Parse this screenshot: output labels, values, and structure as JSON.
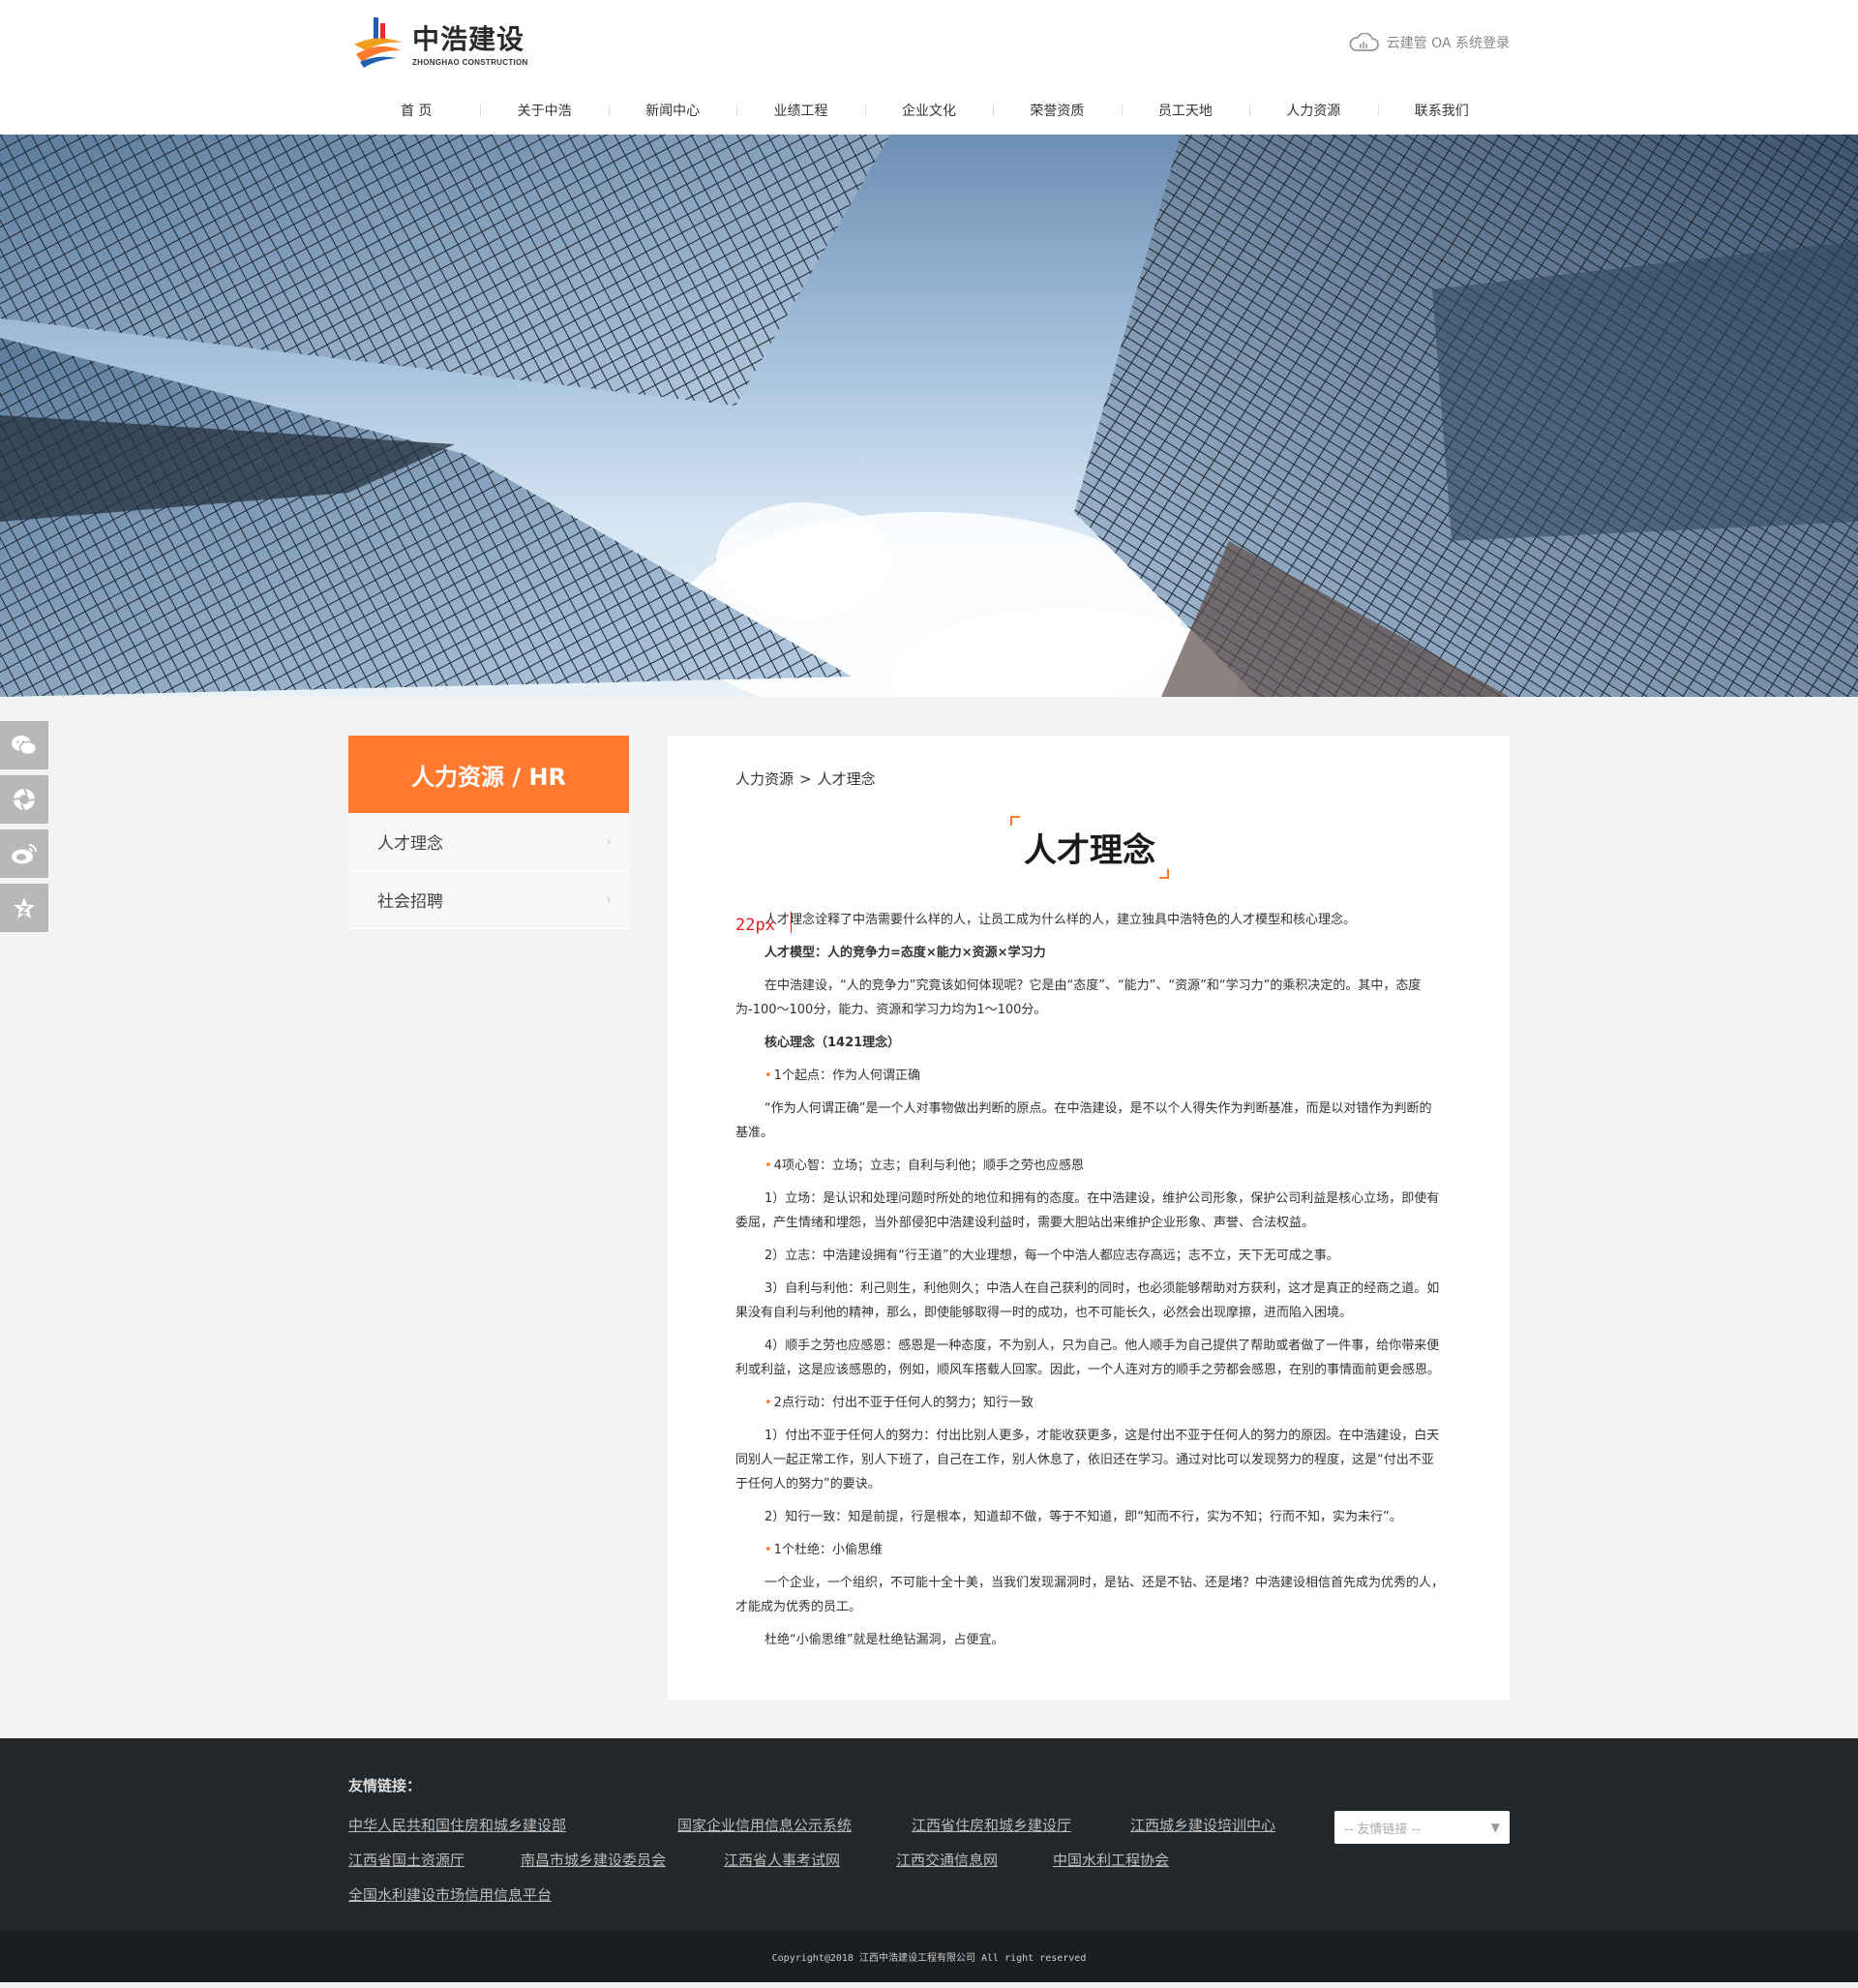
{
  "header": {
    "logo_cn": "中浩建设",
    "logo_en": "ZHONGHAO CONSTRUCTION",
    "oa_login": "云建管 OA 系统登录",
    "nav": [
      "首 页",
      "关于中浩",
      "新闻中心",
      "业绩工程",
      "企业文化",
      "荣誉资质",
      "员工天地",
      "人力资源",
      "联系我们"
    ]
  },
  "sidebar": {
    "title": "人力资源 / HR",
    "items": [
      "人才理念",
      "社会招聘"
    ]
  },
  "content": {
    "breadcrumb": [
      "人力资源",
      "人才理念"
    ],
    "breadcrumb_sep": ">",
    "title": "人才理念",
    "marker": "22px",
    "paragraphs": {
      "p1": "人才理念诠释了中浩需要什么样的人，让员工成为什么样的人，建立独具中浩特色的人才模型和核心理念。",
      "p2": "人才模型：人的竞争力=态度×能力×资源×学习力",
      "p3": "在中浩建设，“人的竞争力”究竟该如何体现呢？它是由“态度”、“能力”、“资源”和“学习力”的乘积决定的。其中，态度为-100～100分，能力、资源和学习力均为1～100分。",
      "p4": "核心理念（1421理念）",
      "p5": "1个起点：作为人何谓正确",
      "p6": "“作为人何谓正确”是一个人对事物做出判断的原点。在中浩建设，是不以个人得失作为判断基准，而是以对错作为判断的基准。",
      "p7": "4项心智：立场；立志；自利与利他；顺手之劳也应感恩",
      "p8": "1）立场：是认识和处理问题时所处的地位和拥有的态度。在中浩建设，维护公司形象，保护公司利益是核心立场，即使有委屈，产生情绪和埋怨，当外部侵犯中浩建设利益时，需要大胆站出来维护企业形象、声誉、合法权益。",
      "p9": "2）立志：中浩建设拥有“行王道”的大业理想，每一个中浩人都应志存高远；志不立，天下无可成之事。",
      "p10": "3）自利与利他：利己则生，利他则久；中浩人在自己获利的同时，也必须能够帮助对方获利，这才是真正的经商之道。如果没有自利与利他的精神，那么，即使能够取得一时的成功，也不可能长久，必然会出现摩擦，进而陷入困境。",
      "p11": "4）顺手之劳也应感恩：感恩是一种态度，不为别人，只为自己。他人顺手为自己提供了帮助或者做了一件事，给你带来便利或利益，这是应该感恩的，例如，顺风车搭载人回家。因此，一个人连对方的顺手之劳都会感恩，在别的事情面前更会感恩。",
      "p12": "2点行动：付出不亚于任何人的努力；知行一致",
      "p13": "1）付出不亚于任何人的努力：付出比别人更多，才能收获更多，这是付出不亚于任何人的努力的原因。在中浩建设，白天同别人一起正常工作，别人下班了，自己在工作，别人休息了，依旧还在学习。通过对比可以发现努力的程度，这是“付出不亚于任何人的努力”的要诀。",
      "p14": "2）知行一致：知是前提，行是根本，知道却不做，等于不知道，即“知而不行，实为不知；行而不知，实为未行”。",
      "p15": "1个杜绝：小偷思维",
      "p16": "一个企业，一个组织，不可能十全十美，当我们发现漏洞时，是钻、还是不钻、还是堵？中浩建设相信首先成为优秀的人，才能成为优秀的员工。",
      "p17": "杜绝“小偷思维”就是杜绝钻漏洞，占便宜。"
    }
  },
  "footer": {
    "title": "友情链接：",
    "links": [
      "中华人民共和国住房和城乡建设部",
      "国家企业信用信息公示系统",
      "江西省住房和城乡建设厅",
      "江西城乡建设培训中心",
      "江西省国土资源厅",
      "南昌市城乡建设委员会",
      "江西省人事考试网",
      "江西交通信息网",
      "中国水利工程协会",
      "全国水利建设市场信用信息平台"
    ],
    "select_placeholder": "-- 友情链接 --",
    "copyright": "Copyright@2018 江西中浩建设工程有限公司 All right reserved"
  },
  "colors": {
    "accent": "#ff7a2f",
    "footer_bg": "#24282b",
    "side_bg": "#f7f7f7"
  },
  "icons": {
    "social": [
      "wechat-icon",
      "camera-aperture-icon",
      "weibo-icon",
      "star-badge-icon"
    ],
    "oa": "cloud-icon"
  }
}
